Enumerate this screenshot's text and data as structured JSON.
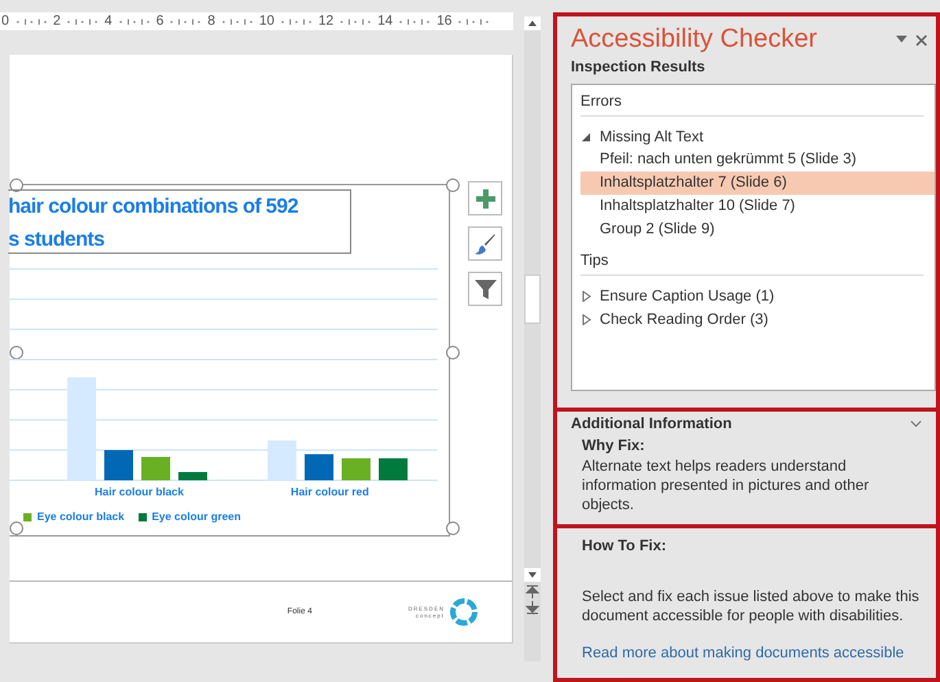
{
  "ruler": {
    "labels": [
      "0",
      "2",
      "4",
      "6",
      "8",
      "10",
      "12",
      "14",
      "16"
    ]
  },
  "slide": {
    "title_lines": [
      "hair colour combinations of 592",
      "s students"
    ],
    "categories": [
      "Hair colour black",
      "Hair colour red"
    ],
    "legend": [
      {
        "label": "Eye colour black",
        "color": "#6ab023"
      },
      {
        "label": "Eye colour green",
        "color": "#007a3d"
      }
    ],
    "footer": "Folie 4",
    "logo": {
      "line_1": "DRESDEN",
      "line_2": "concept"
    }
  },
  "panel": {
    "title": "Accessibility Checker",
    "subtitle": "Inspection Results",
    "groups": [
      {
        "heading": "Errors",
        "items": [
          {
            "label": "Missing Alt Text",
            "expanded": true,
            "children": [
              {
                "label": "Pfeil: nach unten gekrümmt 5  (Slide 3)",
                "selected": false
              },
              {
                "label": "Inhaltsplatzhalter 7  (Slide 6)",
                "selected": true
              },
              {
                "label": "Inhaltsplatzhalter 10  (Slide 7)",
                "selected": false
              },
              {
                "label": "Group 2  (Slide 9)",
                "selected": false
              }
            ]
          }
        ]
      },
      {
        "heading": "Tips",
        "items": [
          {
            "label": "Ensure Caption Usage (1)",
            "expanded": false
          },
          {
            "label": "Check Reading Order (3)",
            "expanded": false
          }
        ]
      }
    ],
    "additional": {
      "heading": "Additional Information",
      "why_title": "Why Fix:",
      "why_text": "Alternate text helps readers understand information presented in pictures and other objects.",
      "how_title": "How To Fix:",
      "how_text": "Select and fix each issue listed above to make this document accessible for people with disabilities.",
      "link": "Read more about making documents accessible"
    }
  }
}
